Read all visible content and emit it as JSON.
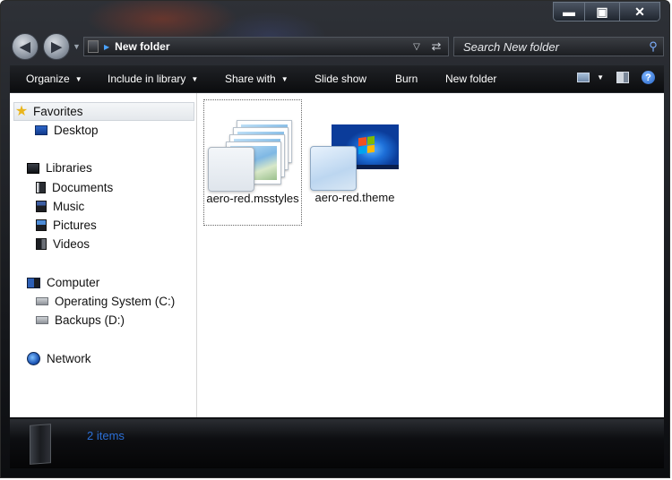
{
  "window": {
    "controls": {
      "minimize": "▬",
      "maximize": "▣",
      "close": "✕"
    }
  },
  "navigation": {
    "back_icon": "back-arrow-icon",
    "forward_icon": "forward-arrow-icon",
    "back_glyph": "◀",
    "forward_glyph": "▶",
    "address_path": "New folder",
    "search_placeholder": "Search New folder"
  },
  "toolbar": {
    "items": [
      {
        "label": "Organize",
        "has_dropdown": true
      },
      {
        "label": "Include in library",
        "has_dropdown": true
      },
      {
        "label": "Share with",
        "has_dropdown": true
      },
      {
        "label": "Slide show",
        "has_dropdown": false
      },
      {
        "label": "Burn",
        "has_dropdown": false
      },
      {
        "label": "New folder",
        "has_dropdown": false
      }
    ],
    "help_glyph": "?"
  },
  "sidebar": {
    "favorites": {
      "label": "Favorites",
      "icon": "star-icon",
      "children": [
        {
          "label": "Desktop",
          "icon": "desktop-icon"
        }
      ]
    },
    "libraries": {
      "label": "Libraries",
      "icon": "libraries-icon",
      "children": [
        {
          "label": "Documents",
          "icon": "documents-icon"
        },
        {
          "label": "Music",
          "icon": "music-icon"
        },
        {
          "label": "Pictures",
          "icon": "pictures-icon"
        },
        {
          "label": "Videos",
          "icon": "videos-icon"
        }
      ]
    },
    "computer": {
      "label": "Computer",
      "icon": "computer-icon",
      "children": [
        {
          "label": "Operating System (C:)",
          "icon": "drive-icon"
        },
        {
          "label": "Backups (D:)",
          "icon": "drive-icon"
        }
      ]
    },
    "network": {
      "label": "Network",
      "icon": "network-icon"
    }
  },
  "files": [
    {
      "name": "aero-red.msstyles",
      "icon": "photo-stack-icon",
      "selected": true
    },
    {
      "name": "aero-red.theme",
      "icon": "theme-icon",
      "selected": false
    }
  ],
  "details": {
    "status": "2 items"
  },
  "colors": {
    "accent": "#2b6fd6",
    "chrome": "#15171b"
  }
}
